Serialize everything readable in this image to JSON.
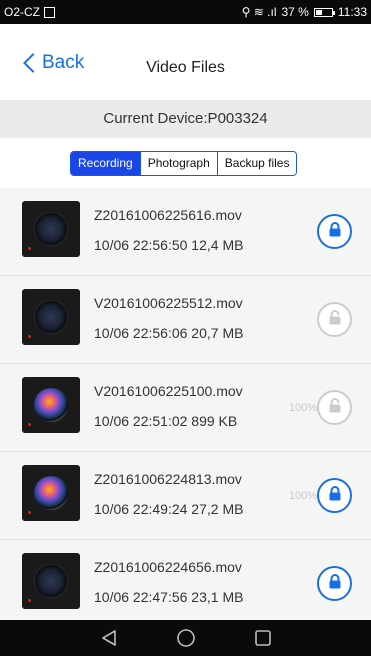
{
  "status_bar": {
    "carrier": "O2-CZ",
    "battery": "37 %",
    "time": "11:33",
    "glyphs": "⚲ ≋ .ıl",
    "battery_level": 0.37
  },
  "header": {
    "back_label": "Back",
    "title": "Video Files"
  },
  "device": {
    "label": "Current Device:P003324"
  },
  "tabs": [
    {
      "label": "Recording",
      "active": true
    },
    {
      "label": "Photograph",
      "active": false
    },
    {
      "label": "Backup files",
      "active": false
    }
  ],
  "files": [
    {
      "name": "Z20161006225616.mov",
      "meta": "10/06 22:56:50  12,4 MB",
      "locked": true,
      "progress": "",
      "thumb": "dark"
    },
    {
      "name": "V20161006225512.mov",
      "meta": "10/06 22:56:06  20,7 MB",
      "locked": false,
      "progress": "",
      "thumb": "dark"
    },
    {
      "name": "V20161006225100.mov",
      "meta": "10/06 22:51:02  899 KB",
      "locked": false,
      "progress": "100%",
      "thumb": "color"
    },
    {
      "name": "Z20161006224813.mov",
      "meta": "10/06 22:49:24  27,2 MB",
      "locked": true,
      "progress": "100%",
      "thumb": "color"
    },
    {
      "name": "Z20161006224656.mov",
      "meta": "10/06 22:47:56  23,1 MB",
      "locked": true,
      "progress": "",
      "thumb": "dark"
    }
  ],
  "icons": {
    "back": "chevron-left-icon",
    "lock": "lock-icon",
    "nav": [
      "back-triangle-icon",
      "home-circle-icon",
      "recents-square-icon"
    ]
  },
  "colors": {
    "accent": "#1a6ee8",
    "tab_active": "#1a46e8",
    "disabled": "#cccccc"
  }
}
